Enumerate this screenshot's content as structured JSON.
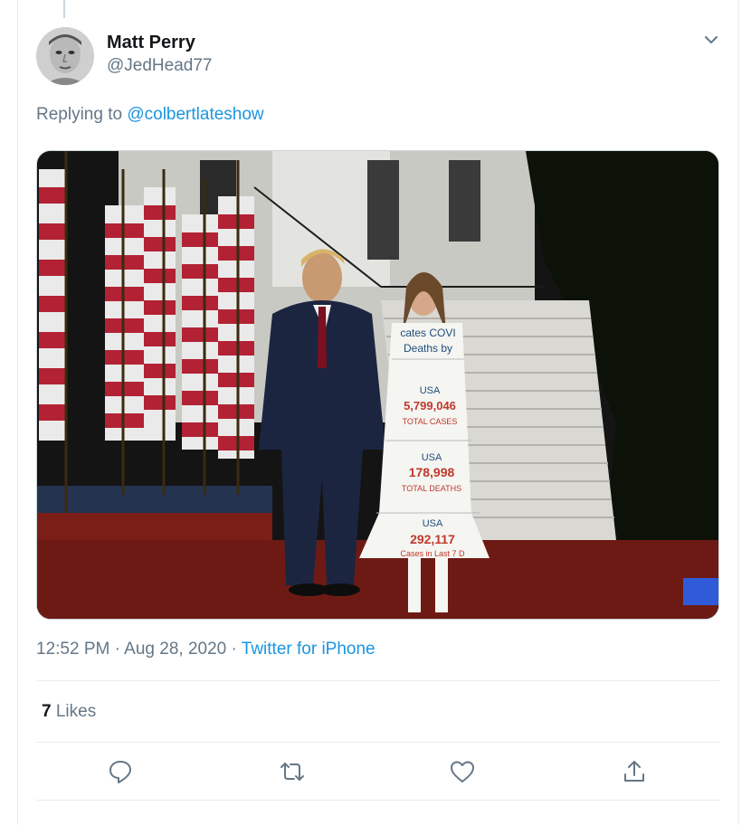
{
  "tweet": {
    "author_name": "Matt Perry",
    "author_handle": "@JedHead77",
    "replying_prefix": "Replying to ",
    "replying_to": "@colbertlateshow",
    "time": "12:52 PM",
    "date": "Aug 28, 2020",
    "separator": "·",
    "source": "Twitter for iPhone"
  },
  "stats": {
    "likes_count": "7",
    "likes_label": "Likes"
  },
  "media": {
    "dress_lines": [
      "cates COVI",
      "Deaths by",
      "USA",
      "5,799,046",
      "TOTAL CASES",
      "USA",
      "178,998",
      "TOTAL DEATHS",
      "USA",
      "292,117",
      "Cases in Last 7 D"
    ]
  },
  "icons": {
    "caret": "chevron-down-icon",
    "reply": "reply-icon",
    "retweet": "retweet-icon",
    "like": "heart-icon",
    "share": "share-icon"
  },
  "colors": {
    "link": "#1b95e0",
    "secondary_text": "#657786",
    "border": "#e6ecf0"
  }
}
